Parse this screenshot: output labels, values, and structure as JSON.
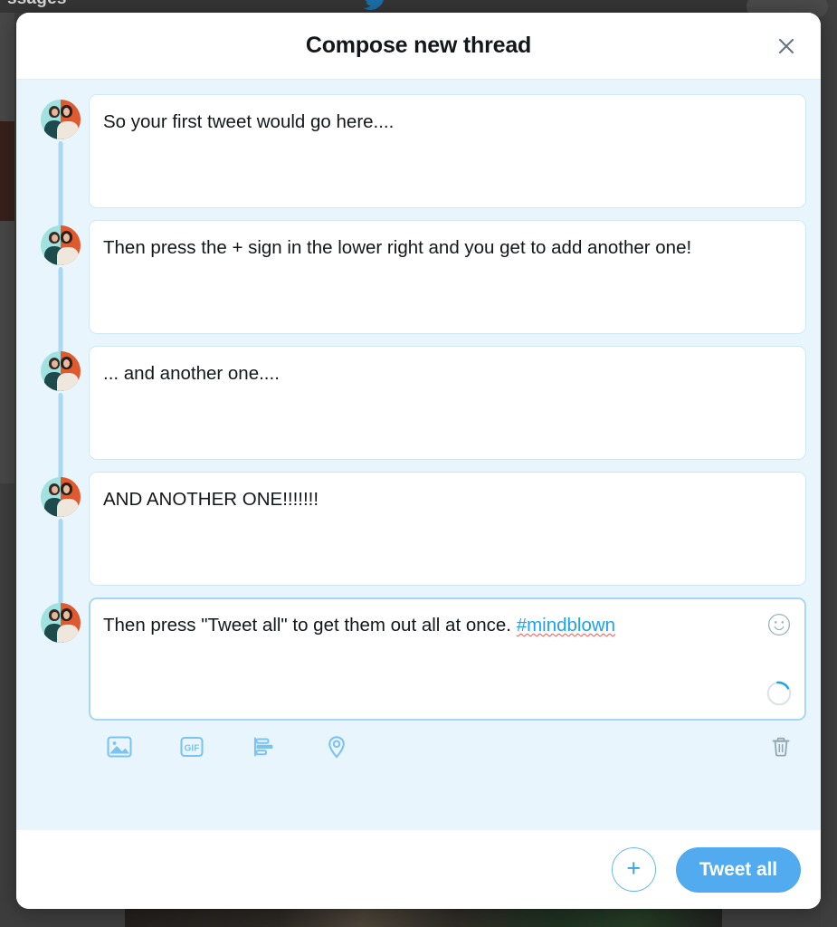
{
  "backdrop": {
    "page_label": "ssages",
    "bird_icon": "twitter-bird-icon"
  },
  "modal": {
    "title": "Compose new thread",
    "close_icon": "close-icon"
  },
  "thread": {
    "avatar_icon": "avatar",
    "tweets": [
      {
        "text": "So your first tweet would go here....",
        "focused": false
      },
      {
        "text": "Then press the + sign in the lower right and you get to add another one!",
        "focused": false
      },
      {
        "text": "... and another one....",
        "focused": false
      },
      {
        "text": "AND ANOTHER ONE!!!!!!!",
        "focused": false
      },
      {
        "text": "Then press \"Tweet all\" to get them out all at once. ",
        "hashtag": "#mindblown",
        "focused": true,
        "emoji_icon": "emoji-smiley-icon",
        "char_progress_percent": 16
      }
    ]
  },
  "attachments": {
    "items": [
      {
        "icon": "image-icon",
        "label": "Add photos or video"
      },
      {
        "icon": "gif-icon",
        "label": "GIF"
      },
      {
        "icon": "poll-icon",
        "label": "Add poll"
      },
      {
        "icon": "location-icon",
        "label": "Tag location"
      }
    ],
    "delete_icon": "trash-icon",
    "delete_label": "Delete thread"
  },
  "footer": {
    "add_label": "+",
    "add_icon": "plus-icon",
    "tweet_all_label": "Tweet all"
  },
  "colors": {
    "accent": "#1da1f2",
    "tweet_all_bg": "#51abee",
    "thread_bg": "#e9f5fc",
    "connector": "#a8d9f0",
    "composer_border": "#cfe8f7",
    "spellcheck": "#ef5b54",
    "icon_blue": "#7cc3f0",
    "trash_gray": "#8899a6"
  }
}
